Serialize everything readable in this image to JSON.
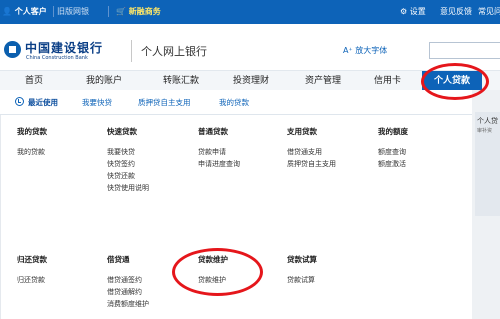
{
  "topbar": {
    "personal": "个人客户",
    "old_version": "旧版网银",
    "new_finance": "新融商务",
    "settings": "设置",
    "feedback": "意见反馈",
    "help": "常见问"
  },
  "brand": {
    "bank_cn": "中国建设银行",
    "bank_en": "China Construction Bank",
    "site_title": "个人网上银行",
    "font_size_label": "A⁺ 放大字体"
  },
  "nav": {
    "items": [
      "首页",
      "我的账户",
      "转账汇款",
      "投资理财",
      "资产管理",
      "信用卡"
    ],
    "active": "个人贷款"
  },
  "subtabs": {
    "recent": "最近使用",
    "quick_loan": "我要快贷",
    "pledge": "质押贷自主支用",
    "my_loan": "我的贷款"
  },
  "menu": {
    "row1": [
      {
        "header": "我的贷款",
        "items": [
          "我的贷款"
        ]
      },
      {
        "header": "快速贷款",
        "items": [
          "我要快贷",
          "快贷签约",
          "快贷还款",
          "快贷使用说明"
        ]
      },
      {
        "header": "普通贷款",
        "items": [
          "贷款申请",
          "申请进度查询"
        ]
      },
      {
        "header": "支用贷款",
        "items": [
          "借贷通支用",
          "质押贷自主支用"
        ]
      },
      {
        "header": "我的额度",
        "items": [
          "额度查询",
          "额度激活"
        ]
      }
    ],
    "row2": [
      {
        "header": "归还贷款",
        "items": [
          "归还贷款"
        ]
      },
      {
        "header": "借贷通",
        "items": [
          "借贷通签约",
          "借贷通解约",
          "消费额度维护"
        ]
      },
      {
        "header": "贷款维护",
        "items": [
          "贷款维护"
        ]
      },
      {
        "header": "贷款试算",
        "items": [
          "贷款试算"
        ]
      }
    ]
  },
  "side": {
    "title": "个人贷",
    "subtitle": "审补资"
  },
  "colors": {
    "brand_blue": "#0d63b8",
    "annotation_red": "#e5161b"
  }
}
